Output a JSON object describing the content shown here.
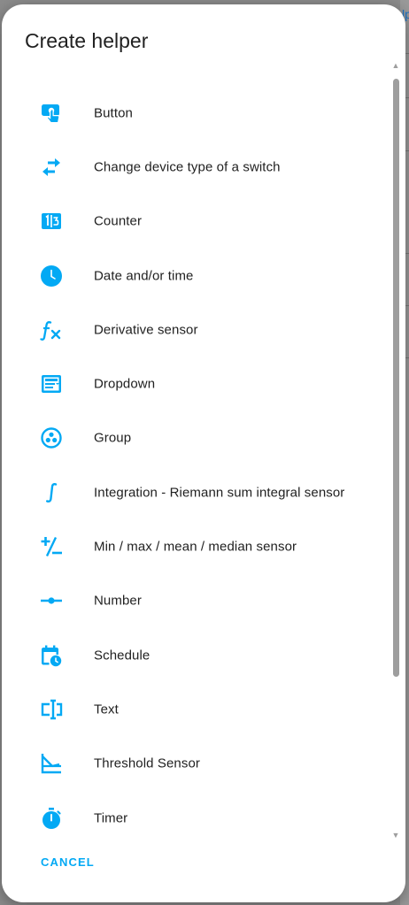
{
  "backdrop": {
    "edge_text": "lp"
  },
  "dialog": {
    "title": "Create helper",
    "cancel_label": "CANCEL",
    "accent_color": "#03a9f4",
    "items": [
      {
        "label": "Button",
        "icon": "gesture-tap-button-icon"
      },
      {
        "label": "Change device type of a switch",
        "icon": "swap-horizontal-icon"
      },
      {
        "label": "Counter",
        "icon": "counter-icon"
      },
      {
        "label": "Date and/or time",
        "icon": "clock-icon"
      },
      {
        "label": "Derivative sensor",
        "icon": "function-variant-icon"
      },
      {
        "label": "Dropdown",
        "icon": "form-dropdown-icon"
      },
      {
        "label": "Group",
        "icon": "google-circles-communities-icon"
      },
      {
        "label": "Integration - Riemann sum integral sensor",
        "icon": "integral-icon"
      },
      {
        "label": "Min / max / mean / median sensor",
        "icon": "plus-minus-icon"
      },
      {
        "label": "Number",
        "icon": "ray-vertex-icon"
      },
      {
        "label": "Schedule",
        "icon": "calendar-clock-icon"
      },
      {
        "label": "Text",
        "icon": "form-textbox-icon"
      },
      {
        "label": "Threshold Sensor",
        "icon": "chart-line-threshold-icon"
      },
      {
        "label": "Timer",
        "icon": "timer-outline-icon"
      }
    ]
  }
}
